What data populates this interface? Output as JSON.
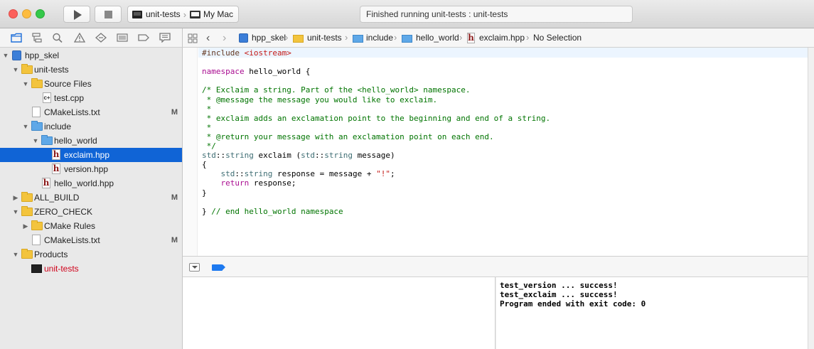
{
  "toolbar": {
    "run_icon": "play-icon",
    "stop_icon": "stop-icon",
    "scheme": {
      "target": "unit-tests",
      "destination": "My Mac"
    },
    "activity_text": "Finished running unit-tests : unit-tests"
  },
  "navigator": {
    "icons": [
      "folder-icon",
      "hierarchy-icon",
      "search-icon",
      "warning-icon",
      "test-diamond-icon",
      "debug-icon",
      "breakpoint-icon",
      "report-icon"
    ],
    "tree": [
      {
        "label": "hpp_skel",
        "icon": "project-icon",
        "disclosure": "▼",
        "badge": ""
      },
      {
        "label": "unit-tests",
        "icon": "folder-yellow-icon",
        "disclosure": "▼",
        "badge": ""
      },
      {
        "label": "Source Files",
        "icon": "folder-yellow-icon",
        "disclosure": "▼",
        "badge": ""
      },
      {
        "label": "test.cpp",
        "icon": "cpp-file-icon",
        "disclosure": "",
        "badge": ""
      },
      {
        "label": "CMakeLists.txt",
        "icon": "text-file-icon",
        "disclosure": "",
        "badge": "M"
      },
      {
        "label": "include",
        "icon": "folder-blue-icon",
        "disclosure": "▼",
        "badge": ""
      },
      {
        "label": "hello_world",
        "icon": "folder-blue-icon",
        "disclosure": "▼",
        "badge": ""
      },
      {
        "label": "exclaim.hpp",
        "icon": "header-file-icon",
        "disclosure": "",
        "badge": "",
        "selected": true
      },
      {
        "label": "version.hpp",
        "icon": "header-file-icon",
        "disclosure": "",
        "badge": ""
      },
      {
        "label": "hello_world.hpp",
        "icon": "header-file-icon",
        "disclosure": "",
        "badge": ""
      },
      {
        "label": "ALL_BUILD",
        "icon": "folder-yellow-icon",
        "disclosure": "▶",
        "badge": "M"
      },
      {
        "label": "ZERO_CHECK",
        "icon": "folder-yellow-icon",
        "disclosure": "▼",
        "badge": ""
      },
      {
        "label": "CMake Rules",
        "icon": "folder-yellow-icon",
        "disclosure": "▶",
        "badge": ""
      },
      {
        "label": "CMakeLists.txt",
        "icon": "text-file-icon",
        "disclosure": "",
        "badge": "M"
      },
      {
        "label": "Products",
        "icon": "folder-yellow-icon",
        "disclosure": "▼",
        "badge": ""
      },
      {
        "label": "unit-tests",
        "icon": "executable-icon",
        "disclosure": "",
        "badge": "",
        "red": true
      }
    ]
  },
  "jumpbar": {
    "items": [
      "hpp_skel",
      "unit-tests",
      "include",
      "hello_world",
      "exclaim.hpp",
      "No Selection"
    ]
  },
  "editor": {
    "lines": [
      [
        [
          "pp",
          "#include "
        ],
        [
          "str",
          "<iostream>"
        ]
      ],
      [],
      [
        [
          "kw",
          "namespace"
        ],
        [
          "plain",
          " hello_world {"
        ]
      ],
      [],
      [
        [
          "cmt",
          "/* Exclaim a string. Part of the <hello_world> namespace."
        ]
      ],
      [
        [
          "cmt",
          " * @message the message you would like to exclaim."
        ]
      ],
      [
        [
          "cmt",
          " *"
        ]
      ],
      [
        [
          "cmt",
          " * exclaim adds an exclamation point to the beginning and end of a string."
        ]
      ],
      [
        [
          "cmt",
          " *"
        ]
      ],
      [
        [
          "cmt",
          " * @return your message with an exclamation point on each end."
        ]
      ],
      [
        [
          "cmt",
          " */"
        ]
      ],
      [
        [
          "ns",
          "std"
        ],
        [
          "plain",
          "::"
        ],
        [
          "ns",
          "string"
        ],
        [
          "plain",
          " exclaim ("
        ],
        [
          "ns",
          "std"
        ],
        [
          "plain",
          "::"
        ],
        [
          "ns",
          "string"
        ],
        [
          "plain",
          " message)"
        ]
      ],
      [
        [
          "plain",
          "{"
        ]
      ],
      [
        [
          "plain",
          "    "
        ],
        [
          "ns",
          "std"
        ],
        [
          "plain",
          "::"
        ],
        [
          "ns",
          "string"
        ],
        [
          "plain",
          " response = message + "
        ],
        [
          "str",
          "\"!\""
        ],
        [
          "plain",
          ";"
        ]
      ],
      [
        [
          "plain",
          "    "
        ],
        [
          "kw",
          "return"
        ],
        [
          "plain",
          " response;"
        ]
      ],
      [
        [
          "plain",
          "}"
        ]
      ],
      [],
      [
        [
          "plain",
          "} "
        ],
        [
          "cmt",
          "// end hello_world namespace"
        ]
      ]
    ]
  },
  "debug": {
    "console_lines": [
      "test_version ... success!",
      "test_exclaim ... success!",
      "Program ended with exit code: 0"
    ]
  }
}
